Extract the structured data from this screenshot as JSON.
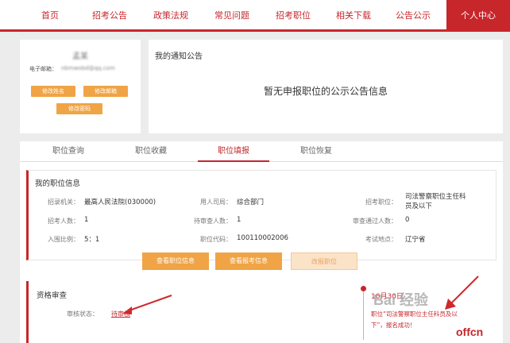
{
  "nav": {
    "items": [
      "首页",
      "招考公告",
      "政策法规",
      "常见问题",
      "招考职位",
      "相关下载",
      "公告公示"
    ],
    "active": "个人中心"
  },
  "profile": {
    "username": "孟某",
    "email_label": "电子邮箱：",
    "email_value": "nbmwobd@qq.com",
    "buttons": {
      "edit_name": "修改姓名",
      "edit_email": "修改邮箱",
      "edit_password": "修改密码"
    }
  },
  "notice": {
    "title": "我的通知公告",
    "empty": "暂无申报职位的公示公告信息"
  },
  "tabs": [
    "职位查询",
    "职位收藏",
    "职位填报",
    "职位恢复"
  ],
  "position": {
    "title": "我的职位信息",
    "rows": [
      [
        {
          "label": "招录机关：",
          "value": "最高人民法院(030000)"
        },
        {
          "label": "用人司局：",
          "value": "综合部门"
        },
        {
          "label": "招考职位：",
          "value": "司法警察职位主任科员及以下"
        }
      ],
      [
        {
          "label": "招考人数：",
          "value": "1"
        },
        {
          "label": "待审查人数：",
          "value": "1"
        },
        {
          "label": "审查通过人数：",
          "value": "0"
        }
      ],
      [
        {
          "label": "入围比例：",
          "value": "5：1"
        },
        {
          "label": "职位代码：",
          "value": "100110002006"
        },
        {
          "label": "考试地点：",
          "value": "辽宁省"
        }
      ]
    ],
    "buttons": {
      "view_position": "查看职位信息",
      "view_application": "查看报考信息",
      "change_position": "改报职位"
    }
  },
  "qualification": {
    "title": "资格审查",
    "status_label": "审核状态：",
    "status_value": "待审核"
  },
  "timeline": {
    "date": "10月30日",
    "line1": "职位“司法警察职位主任科员及以",
    "line2": "下”，报名成功！"
  },
  "watermarks": {
    "baidu": "Bai 经验",
    "site": "offcn"
  },
  "colors": {
    "brand_red": "#c7262b",
    "button_orange": "#f0a446"
  }
}
